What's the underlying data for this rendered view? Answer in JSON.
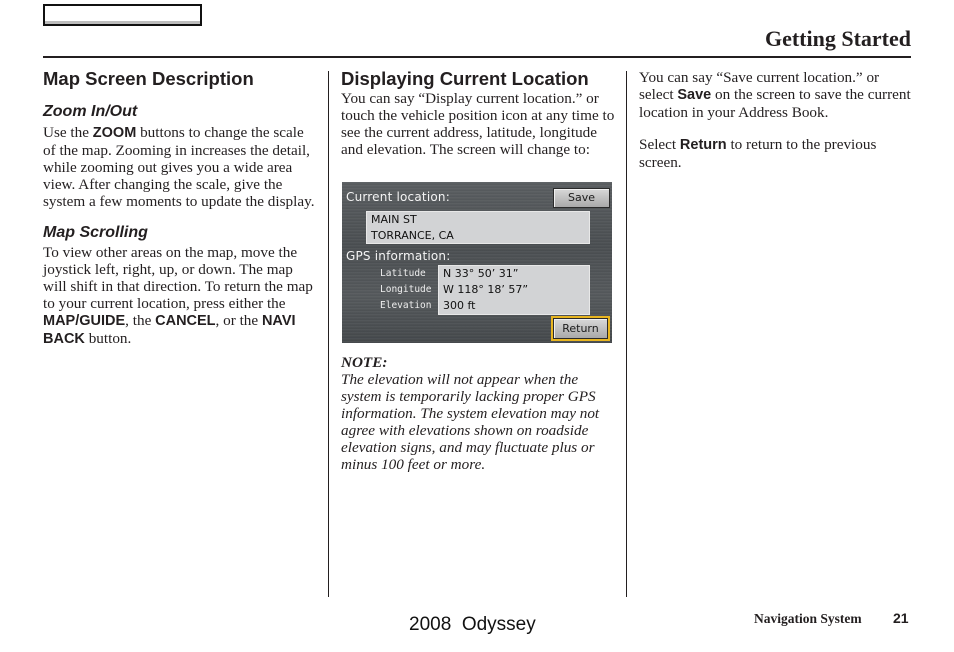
{
  "header": {
    "section_title": "Getting Started"
  },
  "col1": {
    "title": "Map Screen Description",
    "zoom": {
      "heading": "Zoom In/Out",
      "t1": "Use the ",
      "b1": "ZOOM",
      "t2": " buttons to change the scale of the map. Zooming in increases the detail, while zooming out gives you a wide area view. After changing the scale, give the system a few moments to update the display."
    },
    "scroll": {
      "heading": "Map Scrolling",
      "t1": "To view other areas on the map, move the joystick left, right, up, or down. The map will shift in that direction. To return the map to your current location, press either the ",
      "b1": "MAP/GUIDE",
      "t2": ", the ",
      "b2": "CANCEL",
      "t3": ", or the ",
      "b3": "NAVI BACK",
      "t4": " button."
    }
  },
  "col2": {
    "title": "Displaying Current Location",
    "intro": "You can say “Display current location.” or touch the vehicle position icon at any time to see the current address, latitude, longitude and elevation. The screen will change to:",
    "screen": {
      "current_location_label": "Current location:",
      "save_button": "Save",
      "address_line1": "MAIN ST",
      "address_line2": "TORRANCE, CA",
      "gps_label": "GPS information:",
      "latitude_label": "Latitude",
      "longitude_label": "Longitude",
      "elevation_label": "Elevation",
      "latitude_value": "N 33° 50’ 31”",
      "longitude_value": "W 118° 18’ 57”",
      "elevation_value": "300 ft",
      "return_button": "Return",
      "highlight_color": "#e8b520"
    },
    "note_label": "NOTE:",
    "note_body": "The elevation will not appear when the system is temporarily lacking proper GPS information. The system elevation may not agree with elevations shown on roadside elevation signs, and may fluctuate plus or minus 100 feet or more."
  },
  "col3": {
    "p1_t1": "You can say “Save current location.” or select ",
    "p1_b1": "Save",
    "p1_t2": " on the screen to save the current location in your Address Book.",
    "p2_t1": "Select ",
    "p2_b1": "Return",
    "p2_t2": " to return to the previous screen."
  },
  "footer": {
    "model": "2008  Odyssey",
    "manual": "Navigation System",
    "page_number": "21"
  }
}
